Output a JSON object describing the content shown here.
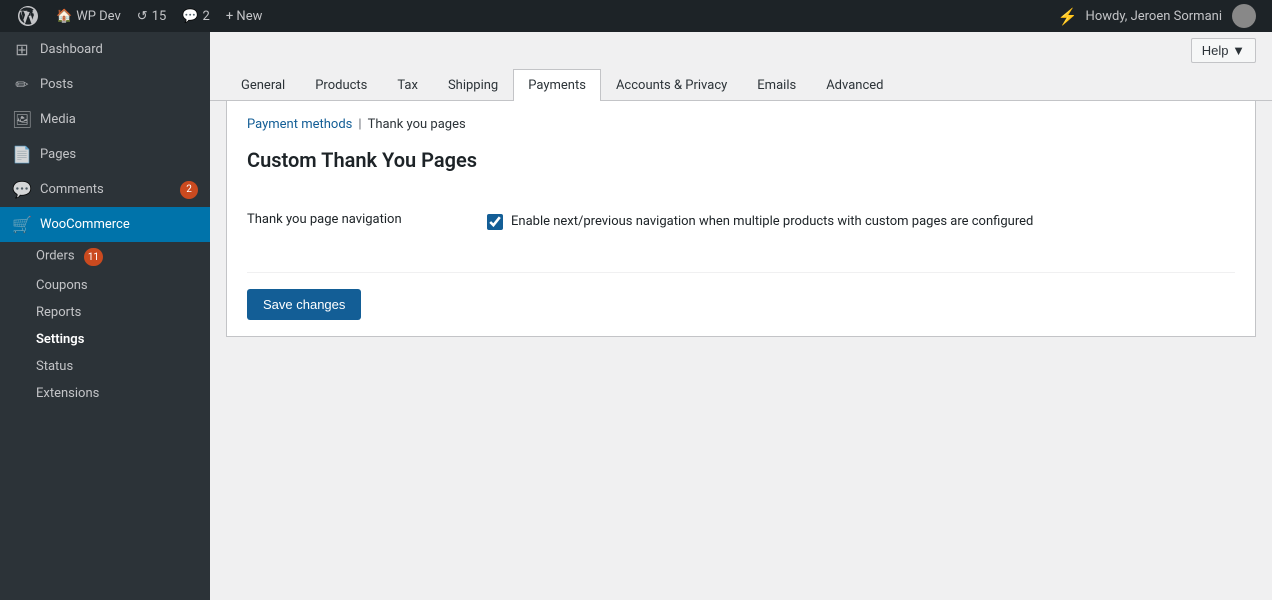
{
  "adminBar": {
    "wpLogoAlt": "WordPress",
    "siteName": "WP Dev",
    "updates": "15",
    "comments": "2",
    "newLabel": "+ New",
    "howdy": "Howdy, Jeroen Sormani",
    "boltIcon": "⚡"
  },
  "sidebar": {
    "items": [
      {
        "id": "dashboard",
        "label": "Dashboard",
        "icon": "⊞"
      },
      {
        "id": "posts",
        "label": "Posts",
        "icon": "✏"
      },
      {
        "id": "media",
        "label": "Media",
        "icon": "🖼"
      },
      {
        "id": "pages",
        "label": "Pages",
        "icon": "📄"
      },
      {
        "id": "comments",
        "label": "Comments",
        "icon": "💬",
        "badge": "2"
      },
      {
        "id": "woocommerce",
        "label": "WooCommerce",
        "icon": "🛒",
        "active": true
      }
    ],
    "wooSubItems": [
      {
        "id": "orders",
        "label": "Orders",
        "badge": "11"
      },
      {
        "id": "coupons",
        "label": "Coupons"
      },
      {
        "id": "reports",
        "label": "Reports"
      },
      {
        "id": "settings",
        "label": "Settings",
        "active": true
      },
      {
        "id": "status",
        "label": "Status"
      },
      {
        "id": "extensions",
        "label": "Extensions"
      }
    ]
  },
  "help": {
    "label": "Help ▼"
  },
  "tabs": [
    {
      "id": "general",
      "label": "General"
    },
    {
      "id": "products",
      "label": "Products"
    },
    {
      "id": "tax",
      "label": "Tax"
    },
    {
      "id": "shipping",
      "label": "Shipping"
    },
    {
      "id": "payments",
      "label": "Payments",
      "active": true
    },
    {
      "id": "accounts-privacy",
      "label": "Accounts & Privacy"
    },
    {
      "id": "emails",
      "label": "Emails"
    },
    {
      "id": "advanced",
      "label": "Advanced"
    }
  ],
  "breadcrumb": {
    "linkText": "Payment methods",
    "separator": "|",
    "currentText": "Thank you pages"
  },
  "pageTitle": "Custom Thank You Pages",
  "settings": {
    "fields": [
      {
        "id": "thank-you-page-navigation",
        "label": "Thank you page navigation",
        "checkboxChecked": true,
        "checkboxText": "Enable next/previous navigation when multiple products with custom pages are configured"
      }
    ]
  },
  "buttons": {
    "saveChanges": "Save changes"
  }
}
